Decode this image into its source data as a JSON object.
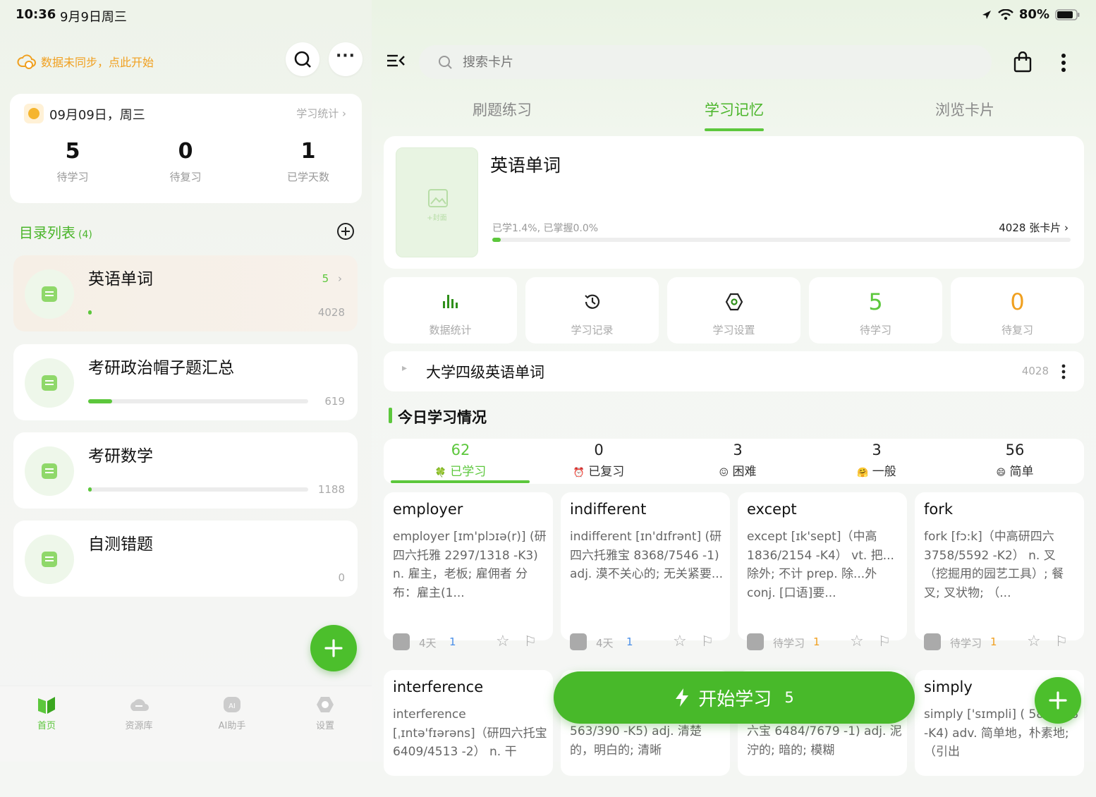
{
  "status_bar": {
    "time": "10:36",
    "date": "9月9日周三",
    "battery": "80%"
  },
  "left": {
    "sync_text": "数据未同步，点此开始",
    "date_card": {
      "date": "09月09日，周三",
      "stats_link": "学习统计",
      "stats": [
        {
          "value": "5",
          "label": "待学习"
        },
        {
          "value": "0",
          "label": "待复习"
        },
        {
          "value": "1",
          "label": "已学天数"
        }
      ]
    },
    "catalog_title": "目录列表",
    "catalog_count": "(4)",
    "decks": [
      {
        "title": "英语单词",
        "badge": "5",
        "count": "4028",
        "progress": 0.014,
        "active": true
      },
      {
        "title": "考研政治帽子题汇总",
        "badge": "",
        "count": "619",
        "progress": 0.11,
        "active": false
      },
      {
        "title": "考研数学",
        "badge": "",
        "count": "1188",
        "progress": 0.0,
        "active": false
      },
      {
        "title": "自测错题",
        "badge": "",
        "count": "0",
        "progress": 0.0,
        "active": false
      }
    ],
    "nav": [
      {
        "label": "首页",
        "icon": "book-icon",
        "active": true
      },
      {
        "label": "资源库",
        "icon": "cloud-icon",
        "active": false
      },
      {
        "label": "AI助手",
        "icon": "ai-icon",
        "active": false
      },
      {
        "label": "设置",
        "icon": "gear-icon",
        "active": false
      }
    ]
  },
  "right": {
    "search_placeholder": "搜索卡片",
    "tabs": [
      "刷题练习",
      "学习记忆",
      "浏览卡片"
    ],
    "active_tab": 1,
    "deck_header": {
      "cover_label": "+封面",
      "title": "英语单词",
      "progress_text": "已学1.4%, 已掌握0.0%",
      "cards_text": "4028 张卡片",
      "progress": 0.014
    },
    "quick": [
      {
        "label": "数据统计",
        "icon": "bar-chart-icon"
      },
      {
        "label": "学习记录",
        "icon": "history-icon"
      },
      {
        "label": "学习设置",
        "icon": "settings-icon"
      },
      {
        "label": "待学习",
        "value": "5"
      },
      {
        "label": "待复习",
        "value": "0"
      }
    ],
    "subdeck": {
      "title": "大学四级英语单词",
      "count": "4028"
    },
    "today_title": "今日学习情况",
    "today": [
      {
        "value": "62",
        "label": "已学习",
        "icon": "🍀"
      },
      {
        "value": "0",
        "label": "已复习",
        "icon": "⏰"
      },
      {
        "value": "3",
        "label": "困难",
        "icon": "😖"
      },
      {
        "value": "3",
        "label": "一般",
        "icon": "🤗"
      },
      {
        "value": "56",
        "label": "简单",
        "icon": "😄"
      }
    ],
    "words": [
      {
        "title": "employer",
        "body": "employer [ɪm'plɔɪə(r)] (研四六托雅 2297/1318 -K3) n. 雇主，老板; 雇佣者 分布：雇主(1...",
        "foot": "4天",
        "n": "1"
      },
      {
        "title": "indifferent",
        "body": "indifferent [ɪn'dɪfrənt] (研四六托雅宝 8368/7546 -1) adj. 漠不关心的; 无关紧要...",
        "foot": "4天",
        "n": "1"
      },
      {
        "title": "except",
        "body": "except [ɪk'sept]（中高 1836/2154 -K4） vt. 把...除外; 不计 prep. 除...外 conj. [口语]要...",
        "foot": "待学习",
        "n": "1"
      },
      {
        "title": "fork",
        "body": "fork [fɔ:k]（中高研四六 3758/5592 -K2） n. 叉（挖掘用的园艺工具）; 餐叉; 叉状物; （...",
        "foot": "待学习",
        "n": "1"
      },
      {
        "title": "interference",
        "body": "interference [ˌɪntə'fɪərəns]（研四六托宝 6409/4513 -2） n. 干"
      },
      {
        "title": "",
        "body": "563/390 -K5) adj. 清楚的，明白的; 清晰"
      },
      {
        "title": "",
        "body": "六宝 6484/7679 -1) adj. 泥泞的; 暗的; 模糊"
      },
      {
        "title": "simply",
        "body": "simply ['sɪmpli] ( 583/568 -K4) adv. 简单地，朴素地;（引出"
      }
    ],
    "start_button": {
      "label": "开始学习",
      "count": "5"
    }
  },
  "colors": {
    "green": "#5cc73c",
    "orange": "#f0a020",
    "blue": "#4a8fe8"
  }
}
